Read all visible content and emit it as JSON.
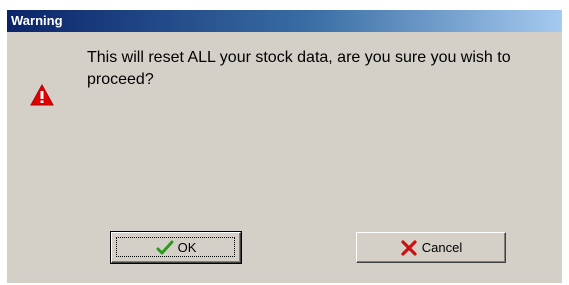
{
  "dialog": {
    "title": "Warning",
    "message": "This will reset ALL your stock data, are you sure you wish to proceed?",
    "icon": "warning-triangle-icon",
    "buttons": {
      "ok_label": "OK",
      "ok_icon": "checkmark-icon",
      "cancel_label": "Cancel",
      "cancel_icon": "x-cross-icon"
    }
  },
  "colors": {
    "titlebar_start": "#0a246a",
    "titlebar_end": "#a6caf0",
    "dialog_bg": "#d4d0c8",
    "warning_red": "#e00000",
    "check_green": "#2c9a1c",
    "cancel_red": "#cc1010"
  }
}
